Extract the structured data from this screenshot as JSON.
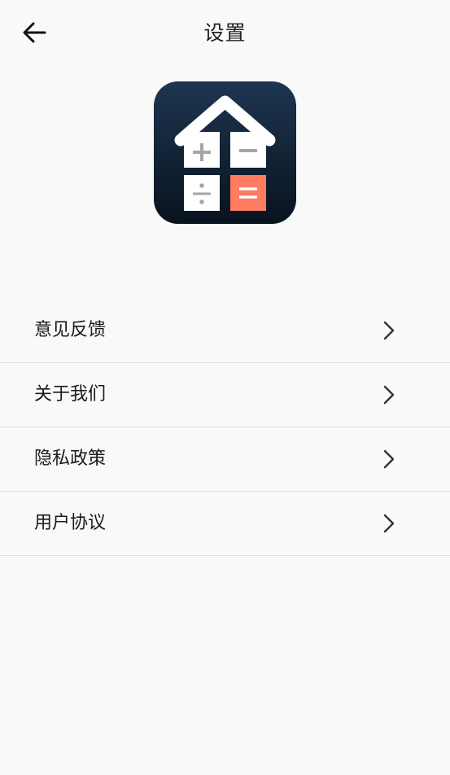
{
  "header": {
    "title": "设置",
    "back_icon": "arrow-left-icon"
  },
  "logo": {
    "icon": "calculator-house-icon",
    "symbols": [
      "+",
      "−",
      "÷",
      "="
    ],
    "colors": {
      "background_top": "#1e3550",
      "background_bottom": "#08131e",
      "key": "#ffffff",
      "key_symbol": "#a6a6a6",
      "equals_key": "#ff7b62"
    }
  },
  "menu": {
    "items": [
      {
        "label": "意见反馈",
        "icon": "chevron-right-icon"
      },
      {
        "label": "关于我们",
        "icon": "chevron-right-icon"
      },
      {
        "label": "隐私政策",
        "icon": "chevron-right-icon"
      },
      {
        "label": "用户协议",
        "icon": "chevron-right-icon"
      }
    ]
  }
}
